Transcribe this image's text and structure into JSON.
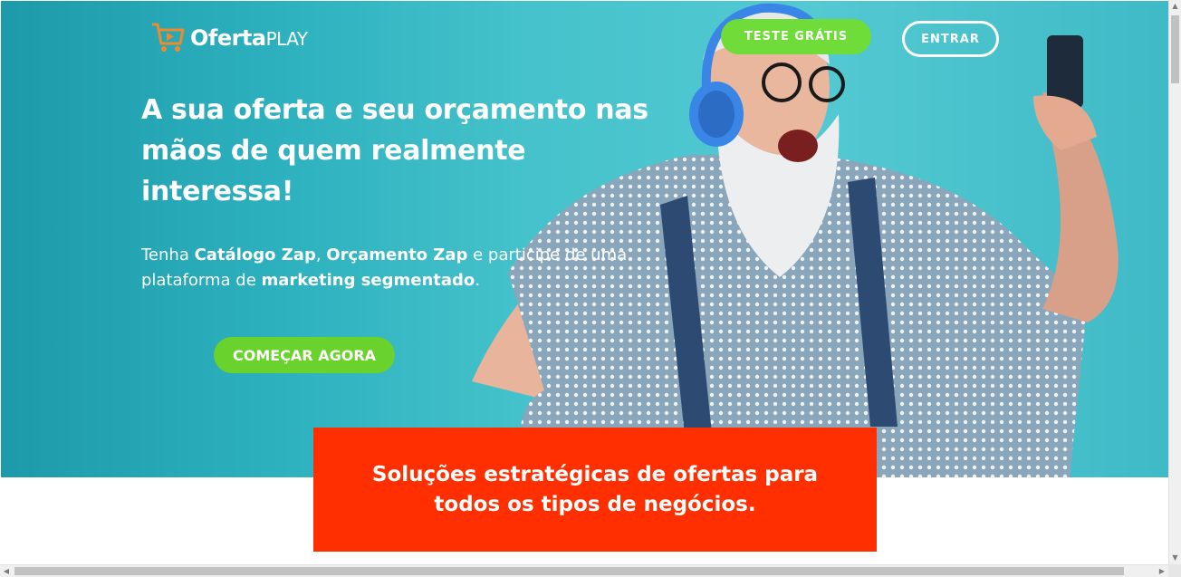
{
  "header": {
    "logo_main": "Oferta",
    "logo_accent": "PLAY",
    "trial_button": "TESTE GRÁTIS",
    "login_button": "ENTRAR"
  },
  "hero": {
    "headline": "A sua oferta e seu orçamento nas mãos de quem realmente interessa!",
    "sub_1": "Tenha ",
    "sub_catalogo": "Catálogo Zap",
    "sub_2": ", ",
    "sub_orcamento": "Orçamento Zap",
    "sub_3": " e participe de uma plataforma de ",
    "sub_marketing": "marketing segmentado",
    "sub_4": ".",
    "cta_button": "COMEÇAR AGORA"
  },
  "banner": {
    "text": "Soluções estratégicas de ofertas para todos os tipos de negócios."
  },
  "icons": {
    "logo": "shopping-cart-play-icon",
    "scroll_up": "arrow-up-icon",
    "scroll_down": "arrow-down-icon",
    "scroll_left": "arrow-left-icon",
    "scroll_right": "arrow-right-icon"
  },
  "colors": {
    "hero_bg": "#45c2cb",
    "cta_green": "#69d22c",
    "banner_red": "#ff2f00",
    "logo_orange": "#f08a2a"
  }
}
